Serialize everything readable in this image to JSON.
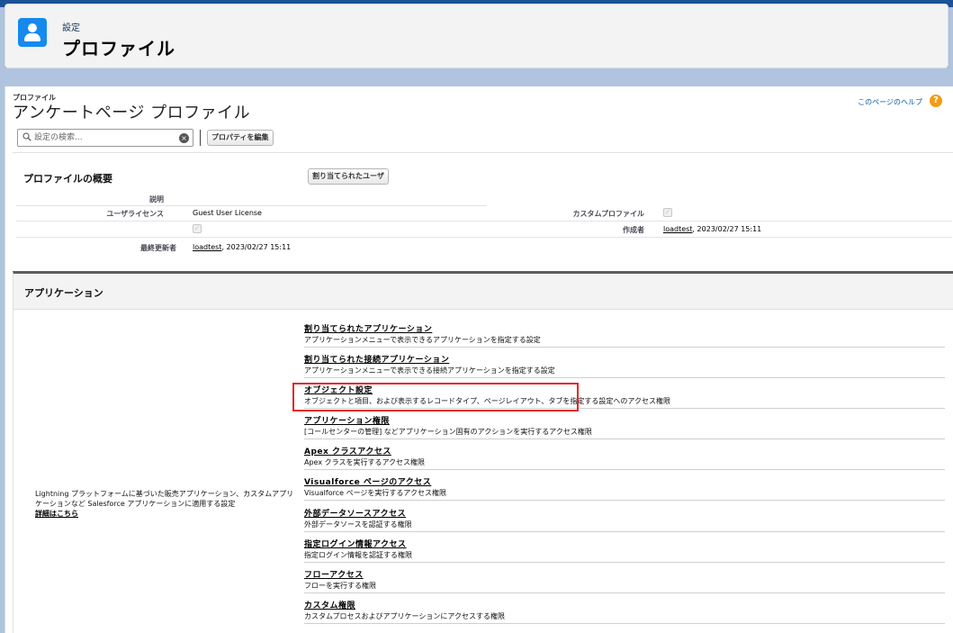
{
  "header": {
    "subtitle": "設定",
    "title": "プロファイル"
  },
  "page": {
    "breadcrumb": "プロファイル",
    "title": "アンケートページ プロファイル",
    "help_link": "このページのヘルプ",
    "help_icon": "?"
  },
  "toolbar": {
    "search_placeholder": "設定の検索...",
    "edit_label": "プロパティを編集"
  },
  "overview": {
    "title": "プロファイルの概要",
    "assigned_users_label": "割り当てられたユーザ",
    "description_label": "説明",
    "user_license_label": "ユーザライセンス",
    "user_license_value": "Guest User License",
    "custom_profile_label": "カスタムプロファイル",
    "created_by_label": "作成者",
    "created_by_user": "loadtest",
    "created_by_date": ", 2023/02/27 15:11",
    "modified_by_label": "最終更新者",
    "modified_by_user": "loadtest",
    "modified_by_date": ", 2023/02/27 15:11"
  },
  "apps": {
    "section_title": "アプリケーション",
    "description": "Lightning プラットフォームに基づいた販売アプリケーション、カスタムアプリケーションなど Salesforce アプリケーションに適用する設定",
    "detail_link": "詳細はこちら",
    "items": [
      {
        "title": "割り当てられたアプリケーション",
        "desc": "アプリケーションメニューで表示できるアプリケーションを指定する設定"
      },
      {
        "title": "割り当てられた接続アプリケーション",
        "desc": "アプリケーションメニューで表示できる接続アプリケーションを指定する設定"
      },
      {
        "title": "オブジェクト設定",
        "desc": "オブジェクトと項目、および表示するレコードタイプ、ページレイアウト、タブを指定する設定へのアクセス権限"
      },
      {
        "title": "アプリケーション権限",
        "desc": "[コールセンターの管理] などアプリケーション固有のアクションを実行するアクセス権限"
      },
      {
        "title": "Apex クラスアクセス",
        "desc": "Apex クラスを実行するアクセス権限"
      },
      {
        "title": "Visualforce ページのアクセス",
        "desc": "Visualforce ページを実行するアクセス権限"
      },
      {
        "title": "外部データソースアクセス",
        "desc": "外部データソースを認証する権限"
      },
      {
        "title": "指定ログイン情報アクセス",
        "desc": "指定ログイン情報を認証する権限"
      },
      {
        "title": "フローアクセス",
        "desc": "フローを実行する権限"
      },
      {
        "title": "カスタム権限",
        "desc": "カスタムプロセスおよびアプリケーションにアクセスする権限"
      }
    ]
  },
  "colors": {
    "brand_icon": "#1589ee",
    "highlight": "#e6262b",
    "help_icon": "#f49b14"
  }
}
